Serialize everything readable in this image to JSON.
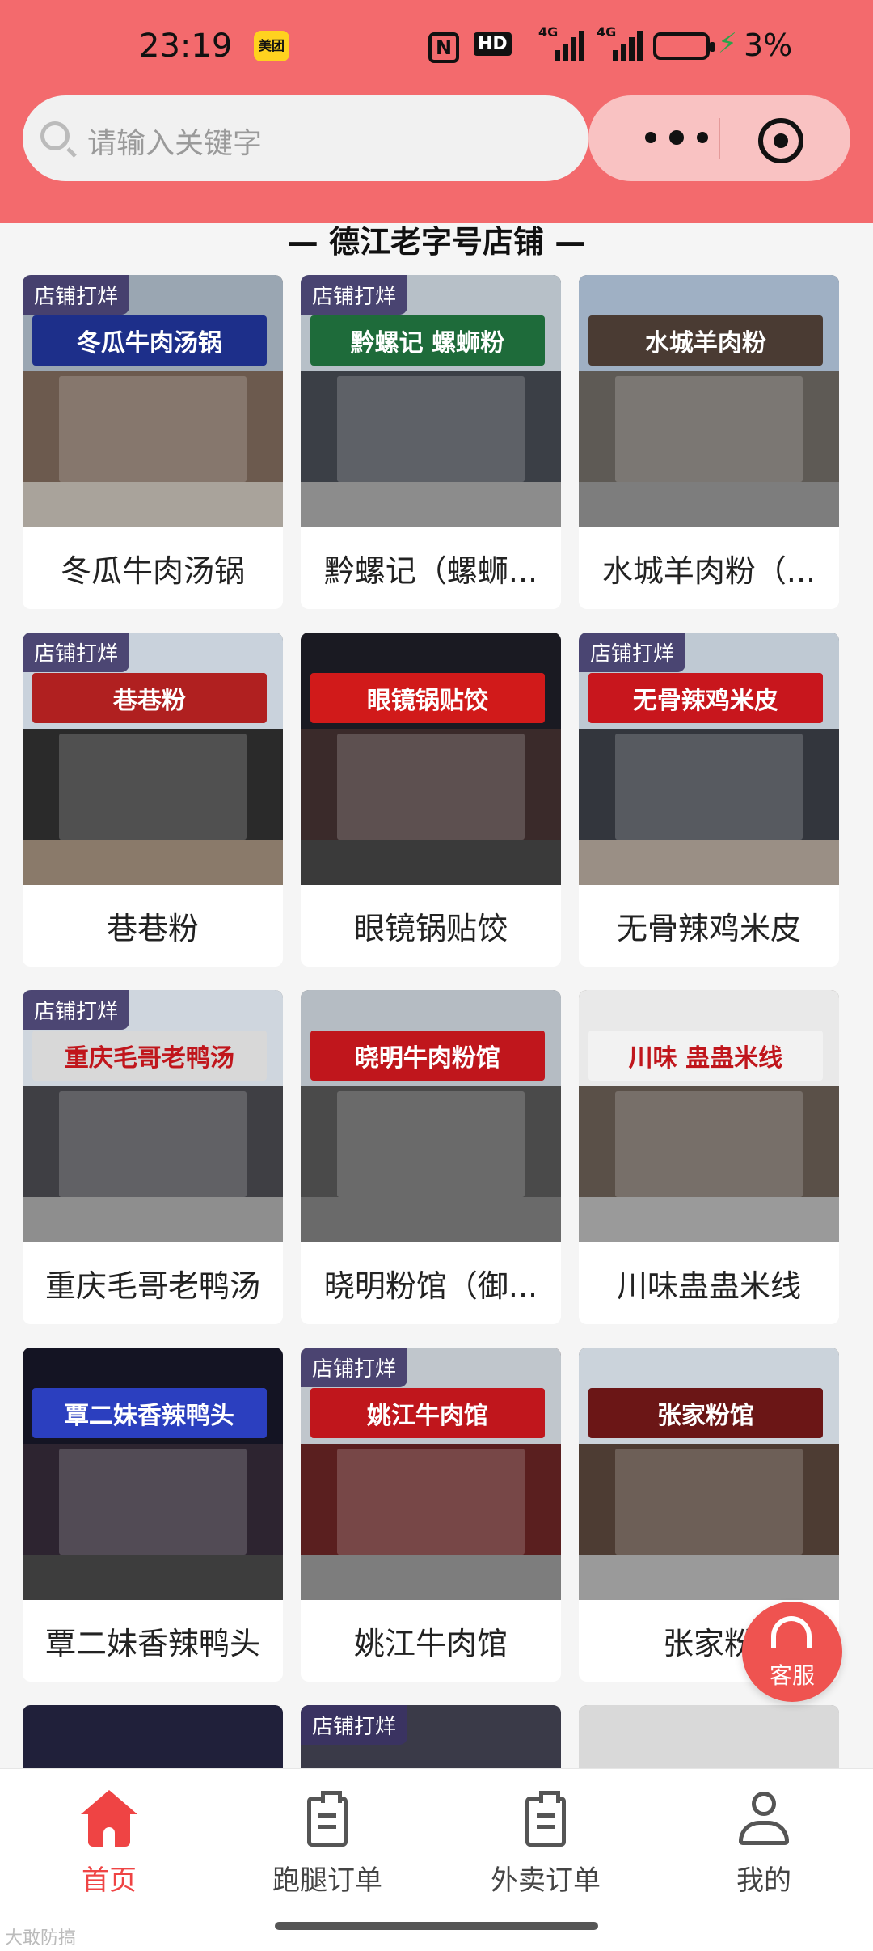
{
  "status_bar": {
    "time": "23:19",
    "app_badge": "美团",
    "nfc": "N",
    "hd": "HD",
    "signal_1": "4G",
    "signal_2": "4G",
    "battery": "3%"
  },
  "search": {
    "placeholder": "请输入关键字"
  },
  "section": {
    "title": "— 德江老字号店铺 —"
  },
  "badge_text": "店铺打烊",
  "stores": [
    {
      "name": "冬瓜牛肉汤锅",
      "closed": true,
      "sign": "冬瓜牛肉汤锅",
      "sign_color": "#1d2f8a"
    },
    {
      "name": "黔螺记（螺蛳...",
      "closed": true,
      "sign": "黔螺记 螺蛳粉",
      "sign_color": "#1e6b3a"
    },
    {
      "name": "水城羊肉粉（...",
      "closed": false,
      "sign": "水城羊肉粉",
      "sign_color": "#4a3b33"
    },
    {
      "name": "巷巷粉",
      "closed": true,
      "sign": "巷巷粉",
      "sign_color": "#b02020"
    },
    {
      "name": "眼镜锅贴饺",
      "closed": false,
      "sign": "眼镜锅贴饺",
      "sign_color": "#d11a1a"
    },
    {
      "name": "无骨辣鸡米皮",
      "closed": true,
      "sign": "无骨辣鸡米皮",
      "sign_color": "#c8161d"
    },
    {
      "name": "重庆毛哥老鸭汤",
      "closed": true,
      "sign": "重庆毛哥老鸭汤",
      "sign_color": "#d8d8d8"
    },
    {
      "name": "晓明粉馆（御...",
      "closed": false,
      "sign": "晓明牛肉粉馆",
      "sign_color": "#c0161c"
    },
    {
      "name": "川味蛊蛊米线",
      "closed": false,
      "sign": "川味 蛊蛊米线",
      "sign_color": "#f2f2f2"
    },
    {
      "name": "覃二妹香辣鸭头",
      "closed": false,
      "sign": "覃二妹香辣鸭头",
      "sign_color": "#2b3fbf"
    },
    {
      "name": "姚江牛肉馆",
      "closed": true,
      "sign": "姚江牛肉馆",
      "sign_color": "#c0161c"
    },
    {
      "name": "张家粉",
      "closed": false,
      "sign": "张家粉馆",
      "sign_color": "#6b1616"
    },
    {
      "name": "",
      "closed": false,
      "sign": "",
      "sign_color": "#2b3fbf"
    },
    {
      "name": "",
      "closed": true,
      "sign": "",
      "sign_color": "#2b2b2b"
    },
    {
      "name": "",
      "closed": false,
      "sign": "",
      "sign_color": "#cfcfcf"
    }
  ],
  "service": {
    "label": "客服"
  },
  "tabs": [
    {
      "label": "首页",
      "icon": "home-icon",
      "active": true
    },
    {
      "label": "跑腿订单",
      "icon": "clipboard-icon",
      "active": false
    },
    {
      "label": "外卖订单",
      "icon": "clipboard-icon",
      "active": false
    },
    {
      "label": "我的",
      "icon": "user-icon",
      "active": false
    }
  ],
  "watermark": "大敢防搞",
  "colors": {
    "header": "#f36a6d",
    "accent": "#ef4444",
    "badge_bg": "#3a3264"
  }
}
